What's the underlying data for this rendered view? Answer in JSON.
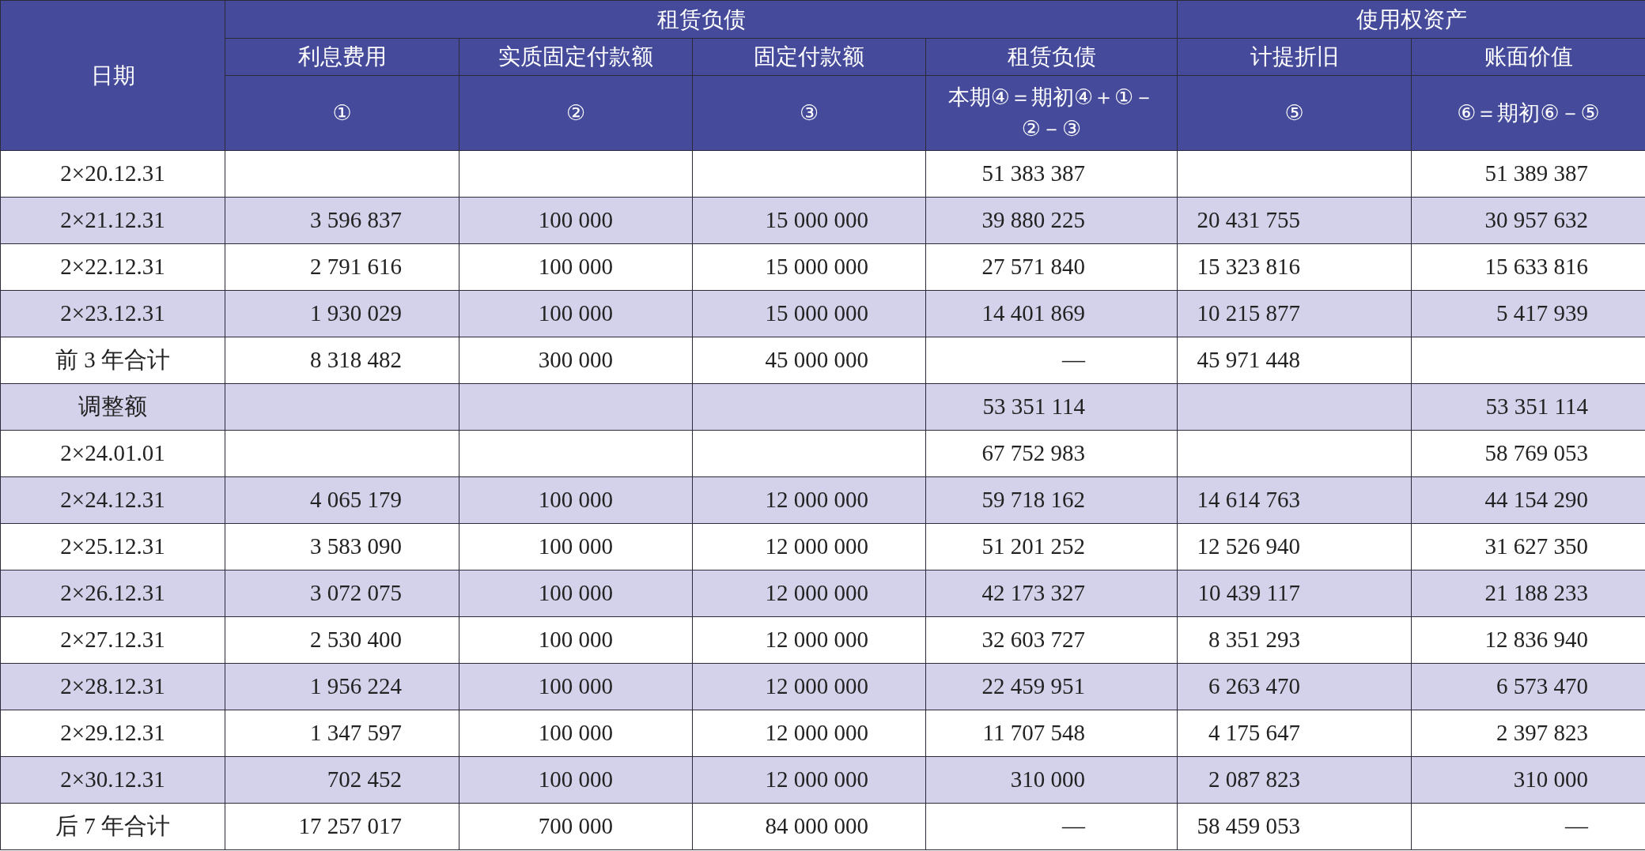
{
  "table": {
    "date_header": "日期",
    "groups": [
      {
        "label": "租赁负债",
        "columns": [
          {
            "label": "利息费用",
            "formula": "①"
          },
          {
            "label": "实质固定付款额",
            "formula": "②"
          },
          {
            "label": "固定付款额",
            "formula": "③"
          },
          {
            "label": "租赁负债",
            "formula": "本期④＝期初④＋①－②－③"
          }
        ]
      },
      {
        "label": "使用权资产",
        "columns": [
          {
            "label": "计提折旧",
            "formula": "⑤"
          },
          {
            "label": "账面价值",
            "formula": "⑥＝期初⑥－⑤"
          }
        ]
      }
    ],
    "rows": [
      {
        "date": "2×20.12.31",
        "cells": [
          null,
          null,
          null,
          "51 383 387",
          null,
          "51 389 387"
        ]
      },
      {
        "date": "2×21.12.31",
        "cells": [
          "3 596 837",
          "100 000",
          "15 000 000",
          "39 880 225",
          "20 431 755",
          "30 957 632"
        ]
      },
      {
        "date": "2×22.12.31",
        "cells": [
          "2 791 616",
          "100 000",
          "15 000 000",
          "27 571 840",
          "15 323 816",
          "15 633 816"
        ]
      },
      {
        "date": "2×23.12.31",
        "cells": [
          "1 930 029",
          "100 000",
          "15 000 000",
          "14 401 869",
          "10 215 877",
          "5 417 939"
        ]
      },
      {
        "date": "前 3 年合计",
        "cells": [
          "8 318 482",
          "300 000",
          "45 000 000",
          "—",
          "45 971 448",
          null
        ]
      },
      {
        "date": "调整额",
        "cells": [
          null,
          null,
          null,
          "53 351 114",
          null,
          "53 351 114"
        ]
      },
      {
        "date": "2×24.01.01",
        "cells": [
          null,
          null,
          null,
          "67 752 983",
          null,
          "58 769 053"
        ]
      },
      {
        "date": "2×24.12.31",
        "cells": [
          "4 065 179",
          "100 000",
          "12 000 000",
          "59 718 162",
          "14 614 763",
          "44 154 290"
        ]
      },
      {
        "date": "2×25.12.31",
        "cells": [
          "3 583 090",
          "100 000",
          "12 000 000",
          "51 201 252",
          "12 526 940",
          "31 627 350"
        ]
      },
      {
        "date": "2×26.12.31",
        "cells": [
          "3 072 075",
          "100 000",
          "12 000 000",
          "42 173 327",
          "10 439 117",
          "21 188 233"
        ]
      },
      {
        "date": "2×27.12.31",
        "cells": [
          "2 530 400",
          "100 000",
          "12 000 000",
          "32 603 727",
          "8 351 293",
          "12 836 940"
        ]
      },
      {
        "date": "2×28.12.31",
        "cells": [
          "1 956 224",
          "100 000",
          "12 000 000",
          "22 459 951",
          "6 263 470",
          "6 573 470"
        ]
      },
      {
        "date": "2×29.12.31",
        "cells": [
          "1 347 597",
          "100 000",
          "12 000 000",
          "11 707 548",
          "4 175 647",
          "2 397 823"
        ]
      },
      {
        "date": "2×30.12.31",
        "cells": [
          "702 452",
          "100 000",
          "12 000 000",
          "310 000",
          "2 087 823",
          "310 000"
        ]
      },
      {
        "date": "后 7 年合计",
        "cells": [
          "17 257 017",
          "700 000",
          "84 000 000",
          "—",
          "58 459 053",
          "—"
        ]
      }
    ]
  }
}
